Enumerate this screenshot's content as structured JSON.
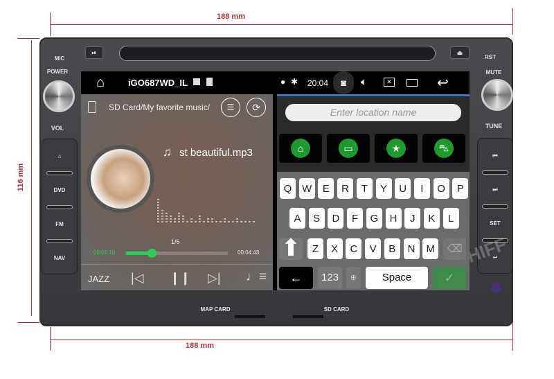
{
  "dimensions": {
    "top_width": "188 mm",
    "bottom_width": "188 mm",
    "height": "116 mm"
  },
  "device": {
    "labels_left": {
      "mic": "MIC",
      "power": "POWER",
      "vol": "VOL"
    },
    "labels_right": {
      "rst": "RST",
      "mute": "MUTE",
      "tune": "TUNE"
    },
    "left_buttons": [
      "⌂",
      "DVD",
      "FM",
      "NAV"
    ],
    "right_buttons": [
      "⏮",
      "⏭",
      "SET",
      "↩"
    ],
    "bottom_labels": {
      "map_card": "MAP CARD",
      "sd_card": "SD CARD"
    },
    "watermark": "HIFF"
  },
  "status_bar": {
    "device_name": "iGO687WD_IL",
    "time": "20:04",
    "icons": [
      "home-icon",
      "image-icon",
      "sd-card-icon",
      "location-icon",
      "bluetooth-icon",
      "camera-icon",
      "volume-icon",
      "close-window-icon",
      "recent-apps-icon",
      "back-icon"
    ]
  },
  "music": {
    "path": "SD Card/My favorite music/",
    "track": "st beautiful.mp3",
    "track_index": "1/6",
    "elapsed": "00:01:10",
    "total": "00:04:43",
    "progress": 0.25,
    "eq_label": "JAZZ",
    "accent": "#2ecc5a"
  },
  "nav": {
    "search_placeholder": "Enter location name",
    "shortcuts": [
      "home",
      "work",
      "favorites",
      "car"
    ],
    "accent": "#1f9a2e"
  },
  "keyboard": {
    "row1": [
      "Q",
      "W",
      "E",
      "R",
      "T",
      "Y",
      "U",
      "I",
      "O",
      "P"
    ],
    "row2": [
      "A",
      "S",
      "D",
      "F",
      "G",
      "H",
      "J",
      "K",
      "L"
    ],
    "row3": [
      "Z",
      "X",
      "C",
      "V",
      "B",
      "N",
      "M"
    ],
    "numbers": "123",
    "space": "Space"
  }
}
